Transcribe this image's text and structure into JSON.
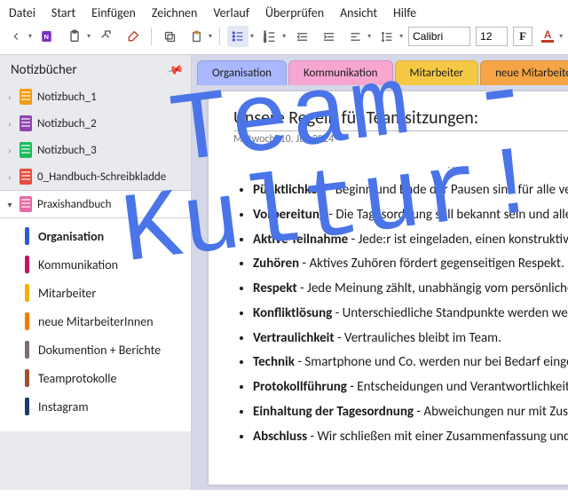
{
  "menu": {
    "items": [
      "Datei",
      "Start",
      "Einfügen",
      "Zeichnen",
      "Verlauf",
      "Überprüfen",
      "Ansicht",
      "Hilfe"
    ]
  },
  "toolbar": {
    "font_name": "Calibri",
    "font_size": "12",
    "bold_label": "F",
    "fontcolor_letter": "A"
  },
  "sidebar": {
    "title": "Notizbücher",
    "notebooks": [
      {
        "label": "Notizbuch_1",
        "colorClass": "nb-orange"
      },
      {
        "label": "Notizbuch_2",
        "colorClass": "nb-purple"
      },
      {
        "label": "Notizbuch_3",
        "colorClass": "nb-green"
      },
      {
        "label": "0_Handbuch-Schreibkladde",
        "colorClass": "nb-red"
      },
      {
        "label": "Praxishandbuch",
        "colorClass": "nb-pink"
      }
    ],
    "sections": [
      {
        "label": "Organisation",
        "colorClass": "c-blue",
        "active": true
      },
      {
        "label": "Kommunikation",
        "colorClass": "c-magenta"
      },
      {
        "label": "Mitarbeiter",
        "colorClass": "c-yellow"
      },
      {
        "label": "neue MitarbeiterInnen",
        "colorClass": "c-orange"
      },
      {
        "label": "Dokumention + Berichte",
        "colorClass": "c-gray"
      },
      {
        "label": "Teamprotokolle",
        "colorClass": "c-brown"
      },
      {
        "label": "Instagram",
        "colorClass": "c-navy"
      }
    ]
  },
  "tabs": [
    {
      "label": "Organisation",
      "cls": "active"
    },
    {
      "label": "Kommunikation",
      "cls": "t-pink"
    },
    {
      "label": "Mitarbeiter",
      "cls": "t-yellow"
    },
    {
      "label": "neue MitarbeiterInnen",
      "cls": "t-orange"
    }
  ],
  "page": {
    "title": "Unsere Regeln für Teamsitzungen:",
    "date": "Mittwoch, 10. Juli 2024",
    "rules": [
      {
        "term": "Pünktlichkeit",
        "text": " - Beginn und Ende der Pausen sind für alle verbindlich."
      },
      {
        "term": "Vorbereitung",
        "text": " - Die Tagesordnung soll bekannt sein und alle Informationen sollten zur Verfügung stehen."
      },
      {
        "term": "Aktive Teilnahme",
        "text": " - Jede:r ist eingeladen, einen konstruktiven Beitrag zu leisten."
      },
      {
        "term": "Zuhören",
        "text": " - Aktives Zuhören fördert gegenseitigen Respekt."
      },
      {
        "term": "Respekt",
        "text": " - Jede Meinung zählt, unabhängig vom persönlichen Standpunkt."
      },
      {
        "term": "Konfliktlösung",
        "text": " - Unterschiedliche Standpunkte werden wertschätzend besprochen."
      },
      {
        "term": "Vertraulichkeit",
        "text": " - Vertrauliches bleibt im Team."
      },
      {
        "term": "Technik",
        "text": " - Smartphone und Co. werden nur bei Bedarf eingesetzt."
      },
      {
        "term": "Protokollführung",
        "text": " - Entscheidungen und Verantwortlichkeiten werden festgehalten."
      },
      {
        "term": "Einhaltung der Tagesordnung",
        "text": " - Abweichungen nur mit Zustimmung aller."
      },
      {
        "term": "Abschluss",
        "text": " - Wir schließen mit einer Zusammenfassung und Ausblick."
      }
    ]
  },
  "overlay": " Team -\nKultur!"
}
